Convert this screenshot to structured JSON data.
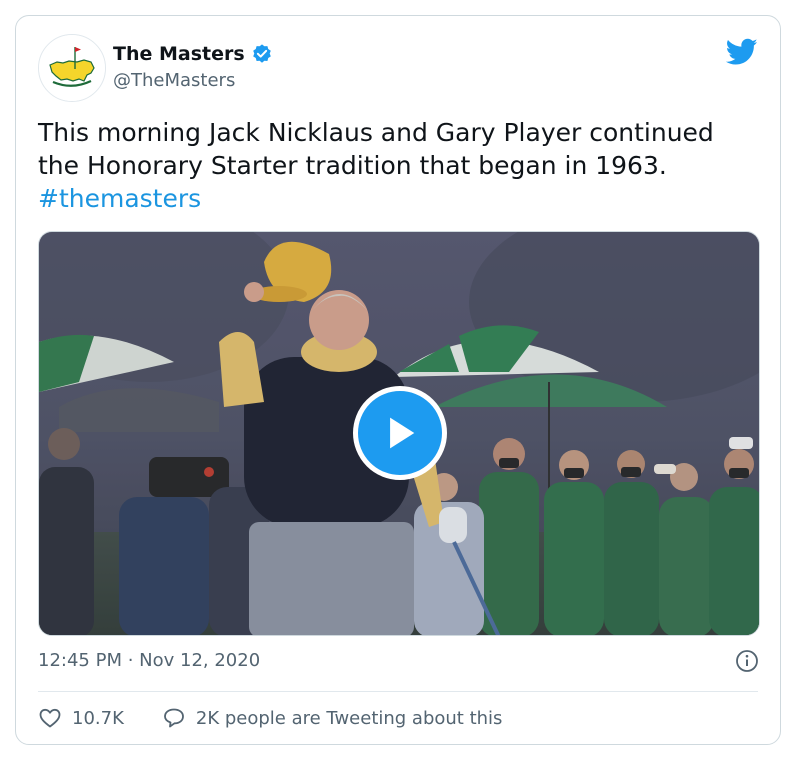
{
  "tweet": {
    "display_name": "The Masters",
    "handle": "@TheMasters",
    "text": "This morning Jack Nicklaus and Gary Player continued the Honorary Starter tradition that began in 1963.",
    "hashtag": "#themasters",
    "timestamp": "12:45 PM · Nov 12, 2020",
    "likes_count": "10.7K",
    "conversation_label": "2K people are Tweeting about this"
  },
  "icons": {
    "verified": "verified-badge-icon",
    "brand": "twitter-bird-icon",
    "play": "play-icon",
    "info": "info-icon",
    "like": "heart-icon",
    "reply": "speech-bubble-icon"
  },
  "colors": {
    "accent": "#1d9bf0",
    "hashtag": "#1b95e0",
    "secondary_text": "#536471",
    "border": "#cfd9de"
  }
}
